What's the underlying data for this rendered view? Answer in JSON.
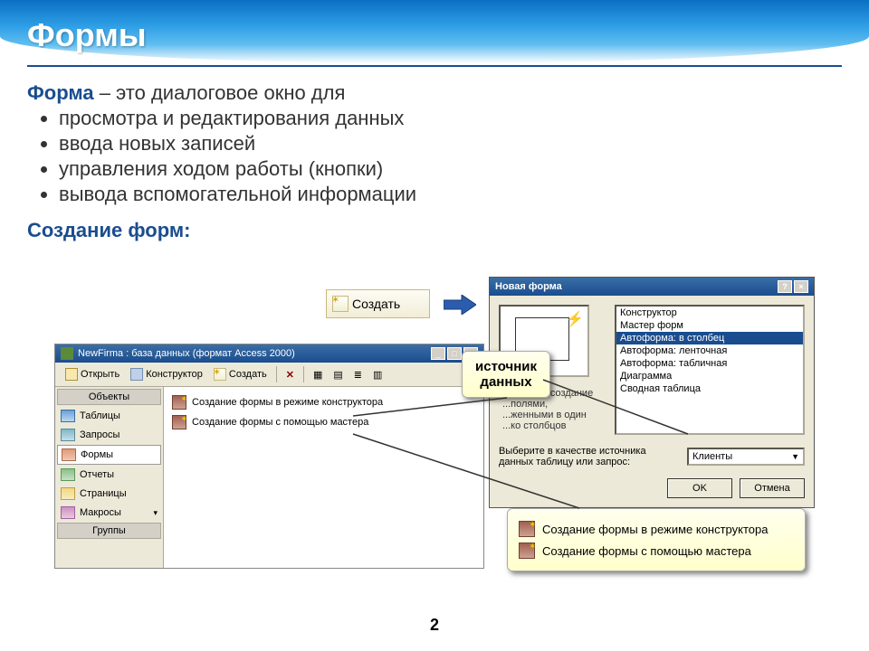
{
  "header": {
    "title": "Формы"
  },
  "definition": {
    "term": "Форма",
    "rest": " – это диалоговое окно для",
    "bullets": [
      "просмотра и редактирования данных",
      "ввода новых записей",
      "управления ходом работы (кнопки)",
      "вывода вспомогательной информации"
    ]
  },
  "sub_heading": "Создание форм:",
  "create_button": {
    "label": "Создать"
  },
  "db_window": {
    "title": "NewFirma : база данных (формат Access 2000)",
    "toolbar": {
      "open": "Открыть",
      "design": "Конструктор",
      "create": "Создать"
    },
    "sidebar": {
      "header": "Объекты",
      "groups": "Группы",
      "items": [
        {
          "label": "Таблицы"
        },
        {
          "label": "Запросы"
        },
        {
          "label": "Формы"
        },
        {
          "label": "Отчеты"
        },
        {
          "label": "Страницы"
        },
        {
          "label": "Макросы"
        }
      ]
    },
    "main": {
      "items": [
        "Создание формы в режиме конструктора",
        "Создание формы с помощью мастера"
      ]
    }
  },
  "new_form_dialog": {
    "title": "Новая форма",
    "list": [
      "Конструктор",
      "Мастер форм",
      "Автоформа: в столбец",
      "Автоформа: ленточная",
      "Автоформа: табличная",
      "Диаграмма",
      "Сводная таблица"
    ],
    "selected_index": 2,
    "desc": "...ическое создание\n...полями,\n...женными в один\n...ко столбцов",
    "label2": "Выберите в качестве источника данных таблицу или запрос:",
    "combo_value": "Клиенты",
    "ok": "OK",
    "cancel": "Отмена"
  },
  "callouts": {
    "source": "источник\nданных",
    "popup_items": [
      "Создание формы в режиме конструктора",
      "Создание формы с помощью мастера"
    ]
  },
  "page_number": "2"
}
